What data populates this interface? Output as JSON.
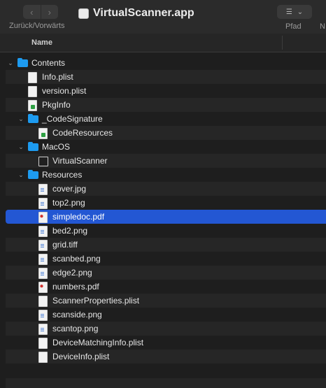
{
  "toolbar": {
    "nav_label": "Zurück/Vorwärts",
    "back_glyph": "‹",
    "forward_glyph": "›",
    "title": "VirtualScanner.app",
    "path_label": "Pfad",
    "cut_label": "N"
  },
  "header": {
    "name": "Name"
  },
  "rows": [
    {
      "label": "Contents",
      "type": "folder",
      "expanded": true
    },
    {
      "label": "Info.plist",
      "type": "doc"
    },
    {
      "label": "version.plist",
      "type": "doc"
    },
    {
      "label": "PkgInfo",
      "type": "pkg"
    },
    {
      "label": "_CodeSignature",
      "type": "folder",
      "expanded": true
    },
    {
      "label": "CodeResources",
      "type": "code"
    },
    {
      "label": "MacOS",
      "type": "folder",
      "expanded": true
    },
    {
      "label": "VirtualScanner",
      "type": "exec"
    },
    {
      "label": "Resources",
      "type": "folder",
      "expanded": true
    },
    {
      "label": "cover.jpg",
      "type": "image"
    },
    {
      "label": "top2.png",
      "type": "image"
    },
    {
      "label": "simpledoc.pdf",
      "type": "pdf",
      "selected": true
    },
    {
      "label": "bed2.png",
      "type": "image"
    },
    {
      "label": "grid.tiff",
      "type": "image"
    },
    {
      "label": "scanbed.png",
      "type": "image"
    },
    {
      "label": "edge2.png",
      "type": "image"
    },
    {
      "label": "numbers.pdf",
      "type": "pdf"
    },
    {
      "label": "ScannerProperties.plist",
      "type": "doc"
    },
    {
      "label": "scanside.png",
      "type": "image"
    },
    {
      "label": "scantop.png",
      "type": "image"
    },
    {
      "label": "DeviceMatchingInfo.plist",
      "type": "doc"
    },
    {
      "label": "DeviceInfo.plist",
      "type": "doc"
    }
  ]
}
